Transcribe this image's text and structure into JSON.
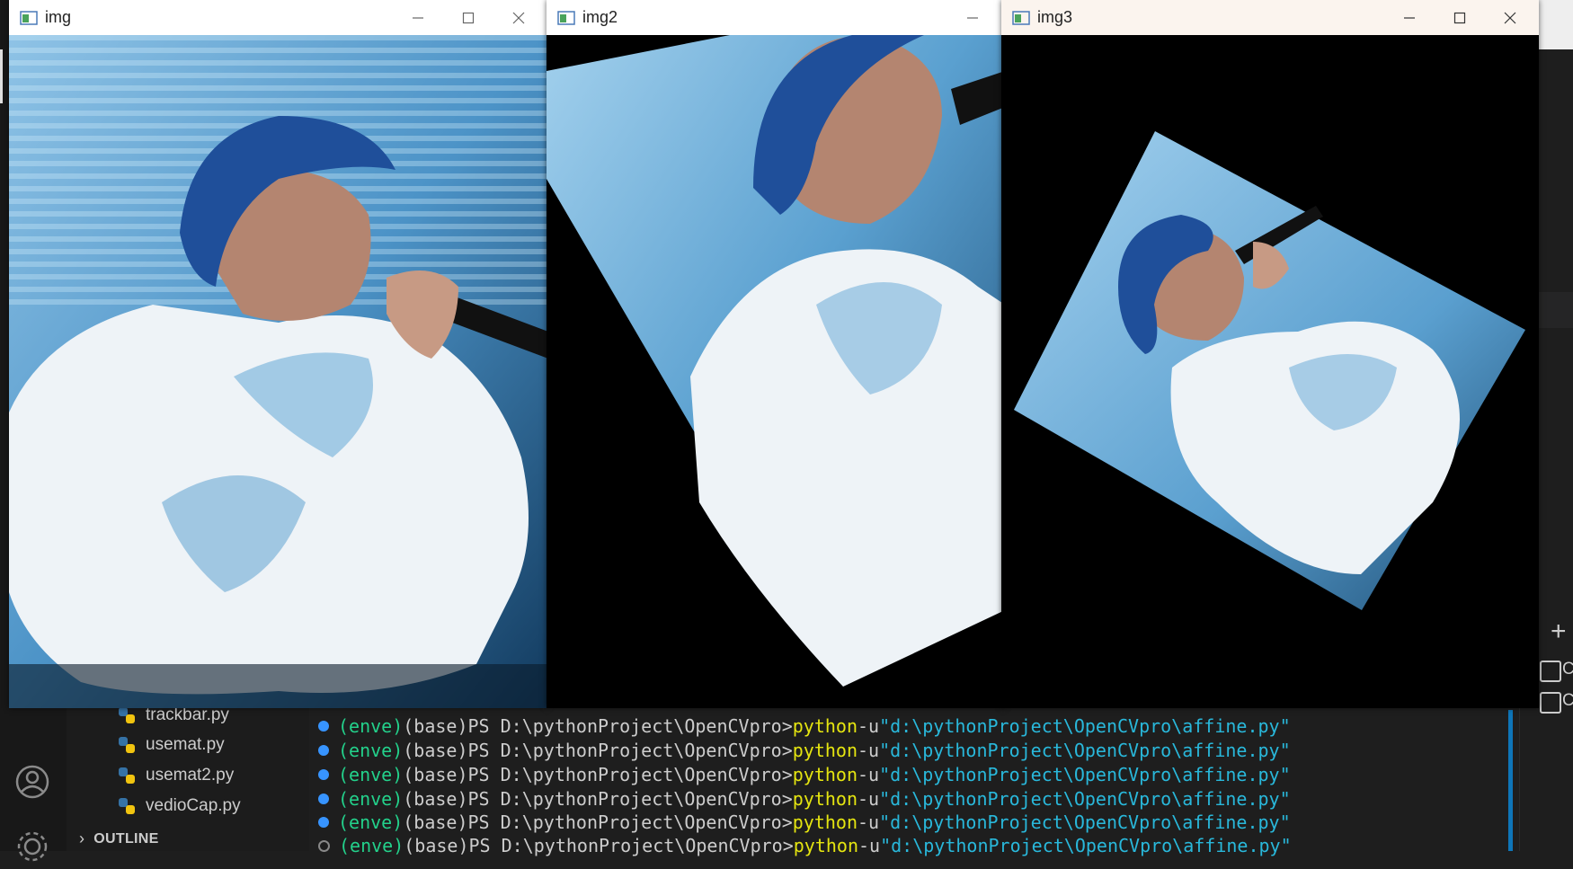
{
  "windows": [
    {
      "title": "img"
    },
    {
      "title": "img2"
    },
    {
      "title": "img3"
    }
  ],
  "explorer": {
    "files": [
      "trackbar.py",
      "usemat.py",
      "usemat2.py",
      "vedioCap.py"
    ],
    "outline_label": "OUTLINE"
  },
  "terminal": {
    "env": "(enve)",
    "base": "(base)",
    "prompt": "PS D:\\pythonProject\\OpenCVpro>",
    "command": "python",
    "flag": "-u",
    "arg": "\"d:\\pythonProject\\OpenCVpro\\affine.py\"",
    "line_count": 6
  },
  "right_panel": {
    "items": [
      "C",
      "C"
    ]
  },
  "colors": {
    "accent": "#0e75b8",
    "terminal_green": "#23d18b",
    "terminal_yellow": "#e5e510",
    "terminal_string": "#29b8db"
  },
  "icons": [
    "account-icon",
    "settings-gear-icon",
    "python-file-icon",
    "opencv-window-icon",
    "minimize-icon",
    "maximize-icon",
    "close-icon",
    "add-terminal-icon",
    "terminal-icon"
  ]
}
